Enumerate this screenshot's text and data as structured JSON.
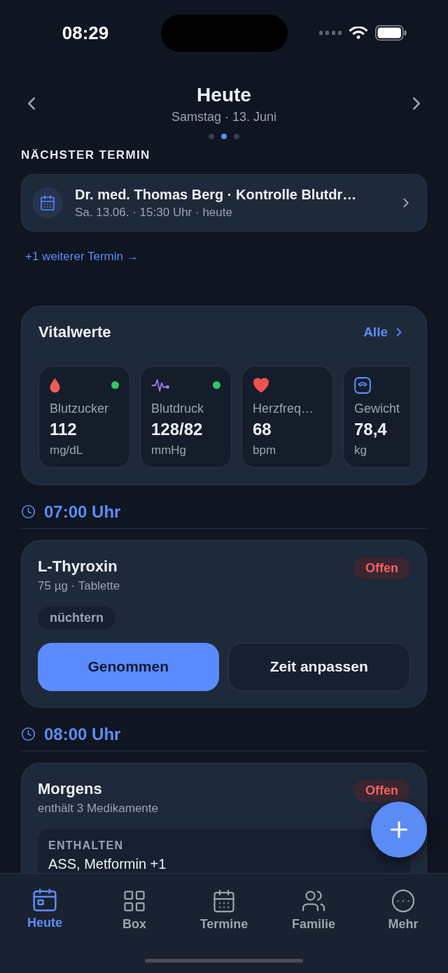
{
  "status_bar": {
    "time": "08:29"
  },
  "header": {
    "title": "Heute",
    "subtitle": "Samstag · 13. Juni",
    "page_dots": [
      {
        "selected": false
      },
      {
        "selected": true
      },
      {
        "selected": false
      }
    ]
  },
  "next_appointment": {
    "heading": "NÄCHSTER TERMIN",
    "title": "Dr. med. Thomas Berg · Kontrolle Blutdr…",
    "details": "Sa. 13.06. · 15:30 Uhr · heute",
    "more_link": "+1 weiterer Termin →"
  },
  "vitals": {
    "title": "Vitalwerte",
    "all_link": "Alle",
    "items": [
      {
        "kind": "blood_sugar",
        "label": "Blutzucker",
        "value": "112",
        "unit": "mg/dL",
        "color": "#34c467"
      },
      {
        "kind": "blood_pressure",
        "label": "Blutdruck",
        "value": "128/82",
        "unit": "mmHg",
        "color": "#34c467"
      },
      {
        "kind": "heart_rate",
        "label": "Herzfreq…",
        "value": "68",
        "unit": "bpm"
      },
      {
        "kind": "weight",
        "label": "Gewicht",
        "value": "78,4",
        "unit": "kg"
      }
    ]
  },
  "schedule": [
    {
      "time": "07:00 Uhr",
      "cards": [
        {
          "kind": "single",
          "name": "L-Thyroxin",
          "details": "75 µg · Tablette",
          "status": "Offen",
          "tags": [
            "nüchtern"
          ],
          "actions": [
            {
              "kind": "primary",
              "label": "Genommen"
            },
            {
              "kind": "secondary",
              "label": "Zeit anpassen"
            }
          ]
        }
      ]
    },
    {
      "time": "08:00 Uhr",
      "cards": [
        {
          "kind": "group",
          "name": "Morgens",
          "details": "enthält 3 Medikamente",
          "status": "Offen",
          "contents_heading": "ENTHALTEN",
          "contents": "ASS, Metformin +1"
        }
      ]
    }
  ],
  "tab_bar": [
    {
      "kind": "today",
      "label": "Heute",
      "selected": true
    },
    {
      "kind": "box",
      "label": "Box",
      "selected": false
    },
    {
      "kind": "appointments",
      "label": "Termine",
      "selected": false
    },
    {
      "kind": "family",
      "label": "Familie",
      "selected": false
    },
    {
      "kind": "more",
      "label": "Mehr",
      "selected": false
    }
  ]
}
